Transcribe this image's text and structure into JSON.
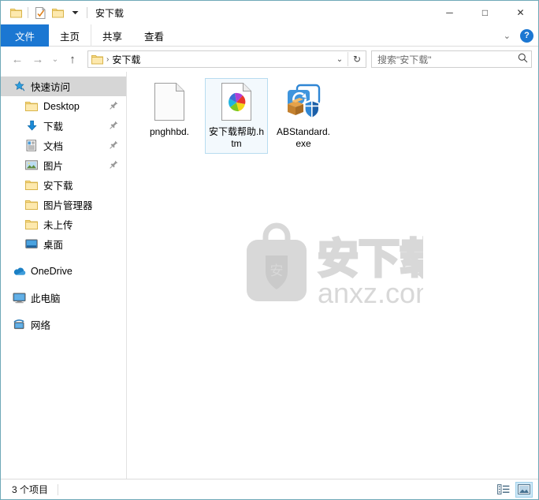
{
  "window": {
    "title": "安下载",
    "controls": {
      "minimize": "─",
      "maximize": "□",
      "close": "✕"
    }
  },
  "quick_access_toolbar": {
    "items": [
      {
        "name": "folder-icon",
        "label": ""
      },
      {
        "name": "properties-icon",
        "label": ""
      },
      {
        "name": "new-folder-icon",
        "label": ""
      },
      {
        "name": "chevron-down-icon",
        "label": "▾"
      }
    ]
  },
  "ribbon": {
    "tabs": [
      {
        "label": "文件",
        "active": true
      },
      {
        "label": "主页",
        "active": false
      },
      {
        "label": "共享",
        "active": false
      },
      {
        "label": "查看",
        "active": false
      }
    ],
    "expand_label": "⌄",
    "help_label": "?"
  },
  "navbar": {
    "back": "←",
    "forward": "→",
    "recent": "⌄",
    "up": "↑",
    "address": {
      "crumb": "安下载",
      "separator": "›",
      "dropdown": "⌄",
      "refresh": "↻"
    },
    "search": {
      "placeholder": "搜索\"安下载\"",
      "icon": "search-icon"
    }
  },
  "sidebar": {
    "items": [
      {
        "label": "快速访问",
        "icon": "star-pin-icon",
        "selected": true,
        "indent": false,
        "pinned": false
      },
      {
        "label": "Desktop",
        "icon": "folder-icon",
        "selected": false,
        "indent": true,
        "pinned": true
      },
      {
        "label": "下载",
        "icon": "downloads-icon",
        "selected": false,
        "indent": true,
        "pinned": true
      },
      {
        "label": "文档",
        "icon": "documents-icon",
        "selected": false,
        "indent": true,
        "pinned": true
      },
      {
        "label": "图片",
        "icon": "pictures-icon",
        "selected": false,
        "indent": true,
        "pinned": true
      },
      {
        "label": "安下载",
        "icon": "folder-icon",
        "selected": false,
        "indent": true,
        "pinned": false
      },
      {
        "label": "图片管理器",
        "icon": "folder-icon",
        "selected": false,
        "indent": true,
        "pinned": false
      },
      {
        "label": "未上传",
        "icon": "folder-icon",
        "selected": false,
        "indent": true,
        "pinned": false
      },
      {
        "label": "桌面",
        "icon": "desktop-icon",
        "selected": false,
        "indent": true,
        "pinned": false
      },
      {
        "label": "OneDrive",
        "icon": "onedrive-icon",
        "selected": false,
        "indent": false,
        "pinned": false,
        "gap_before": true
      },
      {
        "label": "此电脑",
        "icon": "this-pc-icon",
        "selected": false,
        "indent": false,
        "pinned": false,
        "gap_before": true
      },
      {
        "label": "网络",
        "icon": "network-icon",
        "selected": false,
        "indent": false,
        "pinned": false,
        "gap_before": true
      }
    ]
  },
  "files": [
    {
      "name": "pnghhbd.",
      "icon": "blank-document-icon",
      "selected": false
    },
    {
      "name": "安下载帮助.htm",
      "icon": "htm-pinwheel-icon",
      "selected": true
    },
    {
      "name": "ABStandard.exe",
      "icon": "installer-package-icon",
      "selected": false
    }
  ],
  "watermark": {
    "text_cn": "安下载",
    "text_url": "anxz.com",
    "badge_char": "安"
  },
  "statusbar": {
    "item_count": "3 个项目",
    "views": [
      {
        "name": "details-view-button",
        "active": false
      },
      {
        "name": "large-icons-view-button",
        "active": true
      }
    ]
  },
  "colors": {
    "accent": "#1b77d2",
    "selection_bg": "#f3f9fd",
    "selection_border": "#b8dcf0",
    "sidebar_selected": "#d6d6d6",
    "watermark_gray": "#d6d6d6"
  }
}
